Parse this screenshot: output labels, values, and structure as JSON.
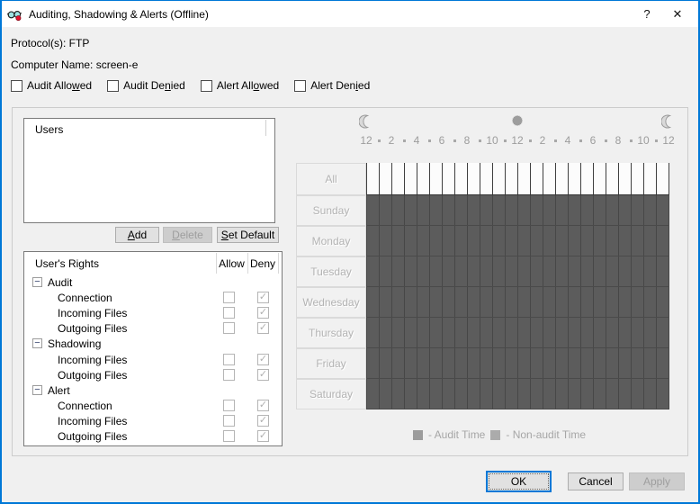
{
  "window": {
    "title": "Auditing, Shadowing & Alerts (Offline)",
    "help_label": "?",
    "close_label": "✕"
  },
  "info": {
    "protocol": "Protocol(s): FTP",
    "computer": "Computer Name: screen-e"
  },
  "filters": [
    {
      "label": "Audit Allo_wed",
      "checked": false
    },
    {
      "label": "Audit De_nied",
      "checked": false
    },
    {
      "label": "Alert All_owed",
      "checked": false
    },
    {
      "label": "Alert Den_ied",
      "checked": false
    }
  ],
  "users_list": {
    "header": "Users",
    "items": []
  },
  "user_buttons": {
    "add": "_Add",
    "delete": "_Delete",
    "set_default": "_Set Default",
    "delete_enabled": false
  },
  "rights": {
    "headers": {
      "name": "User's Rights",
      "allow": "Allow",
      "deny": "Deny"
    },
    "rows": [
      {
        "type": "group",
        "label": "Audit"
      },
      {
        "type": "item",
        "label": "Connection",
        "allow": false,
        "deny": true
      },
      {
        "type": "item",
        "label": "Incoming Files",
        "allow": false,
        "deny": true
      },
      {
        "type": "item",
        "label": "Outgoing Files",
        "allow": false,
        "deny": true
      },
      {
        "type": "group",
        "label": "Shadowing"
      },
      {
        "type": "item",
        "label": "Incoming Files",
        "allow": false,
        "deny": true
      },
      {
        "type": "item",
        "label": "Outgoing Files",
        "allow": false,
        "deny": true
      },
      {
        "type": "group",
        "label": "Alert"
      },
      {
        "type": "item",
        "label": "Connection",
        "allow": false,
        "deny": true
      },
      {
        "type": "item",
        "label": "Incoming Files",
        "allow": false,
        "deny": true
      },
      {
        "type": "item",
        "label": "Outgoing Files",
        "allow": false,
        "deny": true
      }
    ]
  },
  "schedule": {
    "hour_labels": [
      "12",
      "2",
      "4",
      "6",
      "8",
      "10",
      "12",
      "2",
      "4",
      "6",
      "8",
      "10",
      "12"
    ],
    "rows": [
      {
        "label": "All",
        "type": "header"
      },
      {
        "label": "Sunday",
        "state": "audit"
      },
      {
        "label": "Monday",
        "state": "audit"
      },
      {
        "label": "Tuesday",
        "state": "audit"
      },
      {
        "label": "Wednesday",
        "state": "audit"
      },
      {
        "label": "Thursday",
        "state": "audit"
      },
      {
        "label": "Friday",
        "state": "audit"
      },
      {
        "label": "Saturday",
        "state": "audit"
      }
    ],
    "legend": [
      {
        "label": "- Audit Time",
        "color": "#9c9c9c"
      },
      {
        "label": "- Non-audit Time",
        "color": "#ababab"
      }
    ]
  },
  "dialog_buttons": {
    "ok": "OK",
    "cancel": "Cancel",
    "apply": "Apply",
    "apply_enabled": false
  },
  "colors": {
    "accent": "#0078d7",
    "titlebar": "#ffffff",
    "dialog_bg": "#f0f0f0",
    "grid_dark": "#5c5c5c",
    "grid_line": "#474747"
  }
}
